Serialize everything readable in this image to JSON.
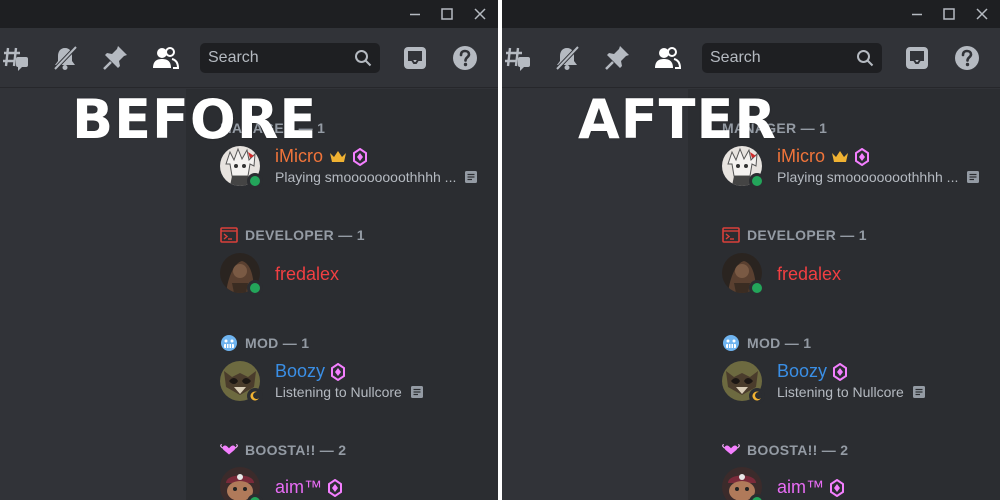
{
  "labels": {
    "before": "BEFORE",
    "after": "AFTER"
  },
  "toolbar": {
    "search_placeholder": "Search",
    "icons": [
      "threads-icon",
      "mute-notifications-icon",
      "pin-icon",
      "member-list-icon",
      "inbox-icon",
      "help-icon"
    ]
  },
  "window_controls": [
    "minimize-icon",
    "maximize-icon",
    "close-icon"
  ],
  "groups": [
    {
      "title": "MANAGER — 1",
      "icon": "none"
    },
    {
      "title": "DEVELOPER — 1",
      "icon": "terminal-icon"
    },
    {
      "title": "MOD — 1",
      "icon": "grimace-emoji-icon"
    },
    {
      "title": "BOOSTA!! — 2",
      "icon": "hearts-icon"
    }
  ],
  "members": [
    {
      "name": "iMicro",
      "activity": "Playing smoooooooothhhh ...",
      "color": "#f0743a",
      "status": "online",
      "badges": [
        "crown-icon",
        "boost-gem-icon"
      ],
      "avatar": "anime-avatar"
    },
    {
      "name": "fredalex",
      "activity": "",
      "color": "#f23f42",
      "status": "online",
      "badges": [],
      "avatar": "dark-avatar"
    },
    {
      "name": "Boozy",
      "activity": "Listening to Nullcore",
      "color": "#3a8fe6",
      "status": "idle",
      "badges": [
        "boost-gem-icon"
      ],
      "avatar": "raccoon-avatar"
    },
    {
      "name": "aim™",
      "activity": "",
      "color": "#e86cf5",
      "status": "online",
      "badges": [
        "boost-gem-icon"
      ],
      "avatar": "creature-avatar"
    }
  ],
  "colors": {
    "background": "#313338",
    "member_list": "#2b2d31",
    "titlebar": "#1e1f22",
    "online": "#23a55a",
    "idle": "#f0b232",
    "muted_text": "#949ba4",
    "boost_pink": "#f47fff",
    "crown_gold": "#f0b232"
  }
}
